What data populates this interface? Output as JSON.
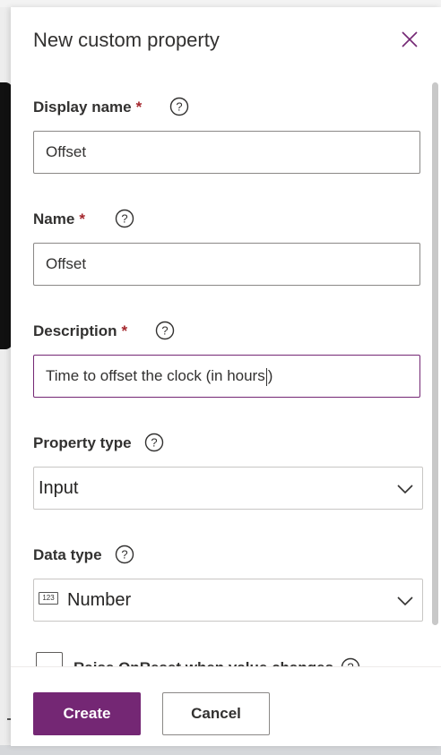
{
  "panel": {
    "title": "New custom property",
    "close_icon": "close-icon"
  },
  "fields": {
    "display_name": {
      "label": "Display name",
      "required_mark": "*",
      "value": "Offset"
    },
    "name": {
      "label": "Name",
      "required_mark": "*",
      "value": "Offset"
    },
    "description": {
      "label": "Description",
      "required_mark": "*",
      "value_before_caret": "Time to offset the clock (in hours",
      "value_after_caret": ")"
    },
    "property_type": {
      "label": "Property type",
      "selected": "Input"
    },
    "data_type": {
      "label": "Data type",
      "selected": "Number",
      "icon": "number-123-icon",
      "icon_text": "123"
    },
    "raise_onreset": {
      "label": "Raise OnReset when value changes",
      "checked": false
    }
  },
  "footer": {
    "create_label": "Create",
    "cancel_label": "Cancel"
  },
  "colors": {
    "accent": "#742774",
    "required": "#a4262c"
  }
}
